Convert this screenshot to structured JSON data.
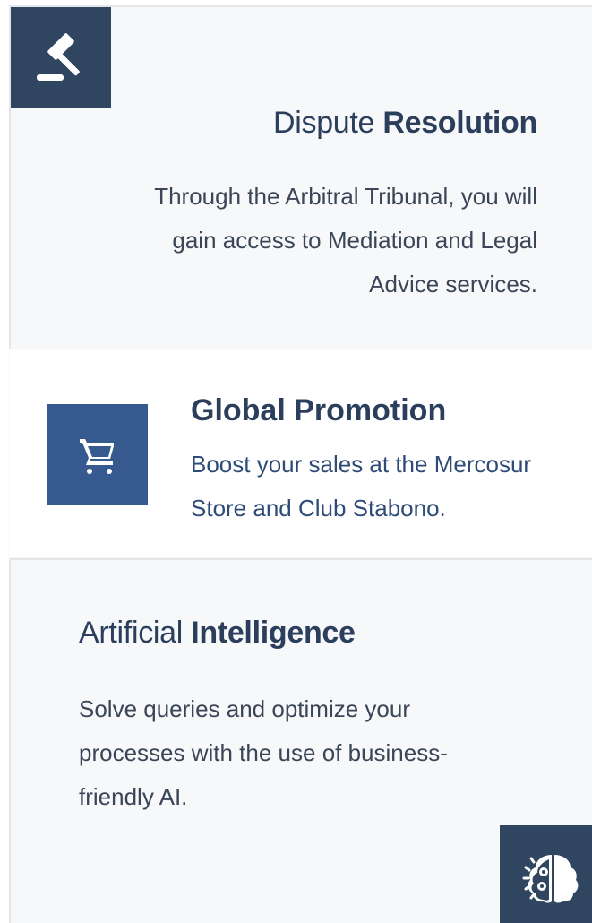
{
  "dispute": {
    "title_light": "Dispute",
    "title_bold": "Resolution",
    "description": "Through the Arbitral Tribunal, you will gain access to Mediation and Legal Advice services.",
    "icon": "gavel-icon"
  },
  "global": {
    "title": "Global Promotion",
    "description_line1": "Boost your sales at the Mercosur",
    "description_line2": "Store and Club Stabono.",
    "icon": "shopping-cart-icon"
  },
  "ai": {
    "title_light": "Artificial",
    "title_bold": "Intelligence",
    "description": "Solve queries and optimize your processes with the use of business-friendly AI.",
    "icon": "brain-gear-icon"
  },
  "colors": {
    "dark_navy": "#2f4560",
    "blue": "#365990",
    "title_text": "#2b3f5c",
    "card_bg": "#f7f8f9"
  }
}
